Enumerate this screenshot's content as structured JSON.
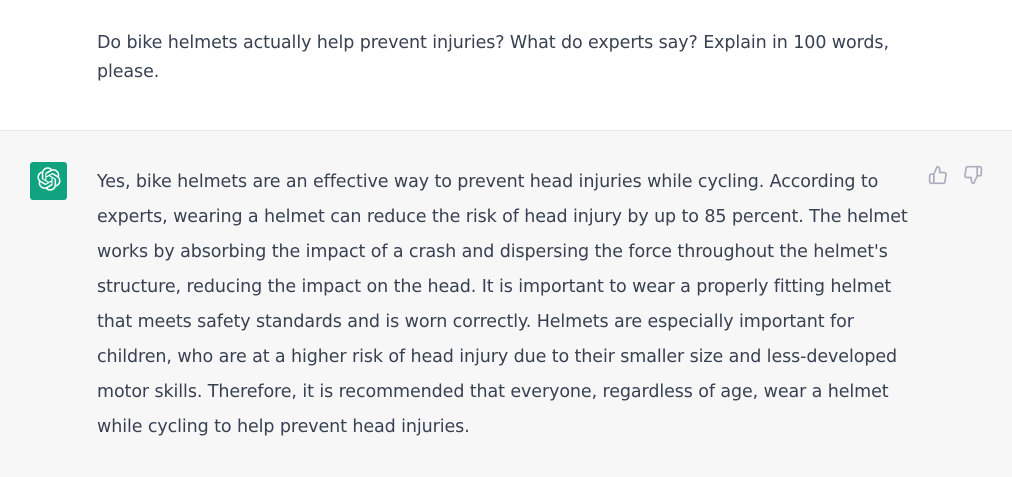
{
  "conversation": {
    "user_message": "Do bike helmets actually help prevent injuries? What do experts say? Explain in 100 words, please.",
    "assistant_message": "Yes, bike helmets are an effective way to prevent head injuries while cycling. According to experts, wearing a helmet can reduce the risk of head injury by up to 85 percent. The helmet works by absorbing the impact of a crash and dispersing the force throughout the helmet's structure, reducing the impact on the head. It is important to wear a properly fitting helmet that meets safety standards and is worn correctly. Helmets are especially important for children, who are at a higher risk of head injury due to their smaller size and less-developed motor skills. Therefore, it is recommended that everyone, regardless of age, wear a helmet while cycling to help prevent head injuries."
  },
  "icons": {
    "avatar": "openai-logo-icon",
    "feedback_up": "thumbs-up-icon",
    "feedback_down": "thumbs-down-icon"
  },
  "colors": {
    "avatar_bg": "#10a37f",
    "assistant_bg": "#f7f7f8",
    "text": "#374151",
    "icon": "#acacbe"
  }
}
